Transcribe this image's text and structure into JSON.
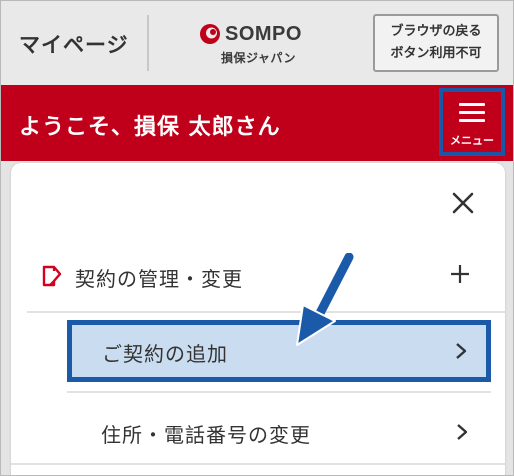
{
  "header": {
    "mypage_label": "マイページ",
    "logo_en": "SOMPO",
    "logo_jp": "損保ジャパン",
    "browser_note_line1": "ブラウザの戻る",
    "browser_note_line2": "ボタン利用不可"
  },
  "welcome": {
    "text": "ようこそ、損保 太郎さん",
    "menu_label": "メニュー"
  },
  "menu": {
    "sections": [
      {
        "label": "契約の管理・変更",
        "items": [
          {
            "label": "ご契約の追加",
            "highlighted": true
          },
          {
            "label": "住所・電話番号の変更",
            "highlighted": false
          }
        ]
      }
    ]
  },
  "colors": {
    "brand_red": "#c0001a",
    "highlight_blue": "#1a5aa8",
    "highlight_fill": "#cadcf0"
  },
  "icons": {
    "close": "close-icon",
    "expand": "plus-icon",
    "item": "chevron-right-icon",
    "contract": "contract-icon",
    "pointer": "arrow-pointer-icon"
  }
}
